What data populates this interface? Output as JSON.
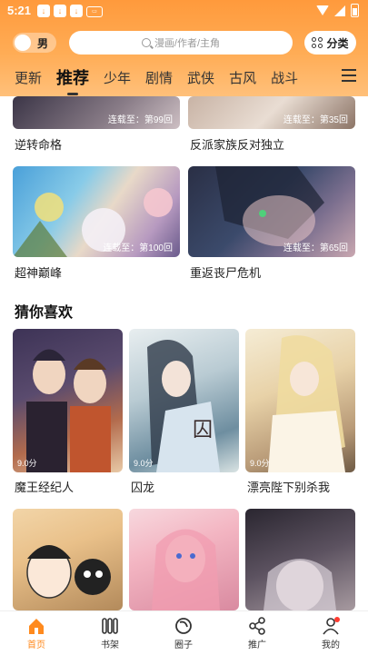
{
  "status_bar": {
    "time": "5:21"
  },
  "header": {
    "gender_label": "男",
    "search_placeholder": "漫画/作者/主角",
    "category_label": "分类",
    "tabs": [
      "更新",
      "推荐",
      "少年",
      "剧情",
      "武侠",
      "古风",
      "战斗"
    ]
  },
  "top_row": [
    {
      "title": "逆转命格",
      "badge": "连载至：第99回"
    },
    {
      "title": "反派家族反对独立",
      "badge": "连载至：第35回"
    }
  ],
  "second_row": [
    {
      "title": "超神巅峰",
      "badge": "连载至：第100回"
    },
    {
      "title": "重返丧尸危机",
      "badge": "连载至：第65回"
    }
  ],
  "guess_section": {
    "title": "猜你喜欢",
    "items": [
      {
        "title": "魔王经纪人",
        "score": "9.0分"
      },
      {
        "title": "囚龙",
        "score": "9.0分"
      },
      {
        "title": "漂亮陛下别杀我",
        "score": "9.0分"
      }
    ]
  },
  "bottom_nav": [
    {
      "label": "首页",
      "icon": "home-icon"
    },
    {
      "label": "书架",
      "icon": "bookshelf-icon"
    },
    {
      "label": "圈子",
      "icon": "circle-icon"
    },
    {
      "label": "推广",
      "icon": "share-icon"
    },
    {
      "label": "我的",
      "icon": "profile-icon"
    }
  ],
  "colors": {
    "accent": "#ff8a1e",
    "header_top": "#ff9a3c"
  }
}
